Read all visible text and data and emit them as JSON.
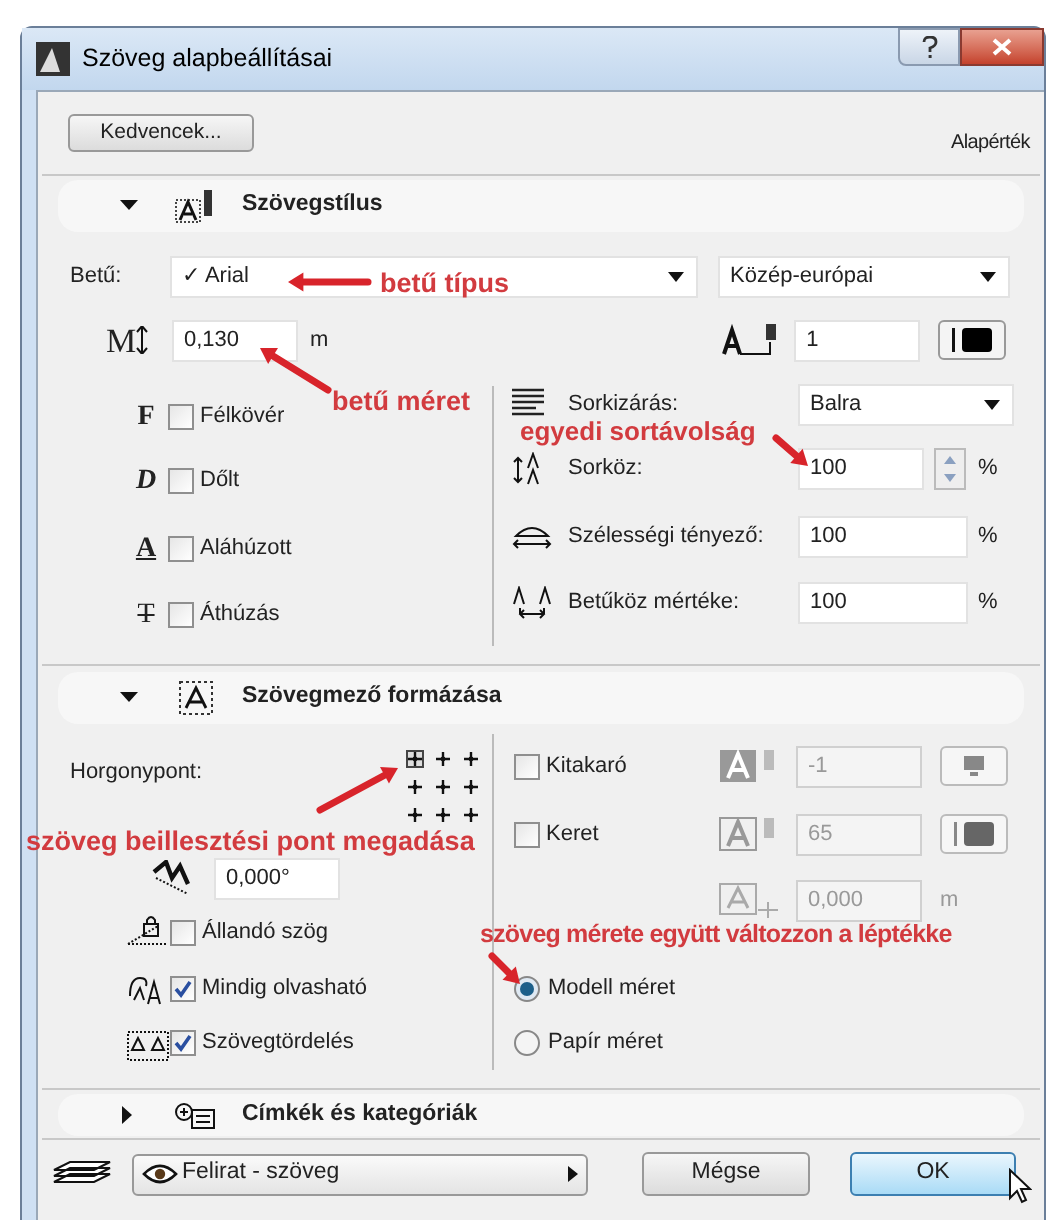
{
  "window": {
    "title": "Szöveg alapbeállításai"
  },
  "toolbar": {
    "favorites_button": "Kedvencek...",
    "default_label": "Alapérték"
  },
  "text_style": {
    "title": "Szövegstílus",
    "expanded": true,
    "font_label": "Betű:",
    "font": "✓ Arial",
    "charset": "Közép-európai",
    "size_icon": "M",
    "size": "0,130",
    "size_unit": "m",
    "pen": "1",
    "styles": [
      {
        "kind": "bold",
        "icon": "F",
        "label": "Félkövér",
        "checked": false
      },
      {
        "kind": "italic",
        "icon": "D",
        "label": "Dőlt",
        "checked": false
      },
      {
        "kind": "underline",
        "icon": "A",
        "label": "Aláhúzott",
        "checked": false
      },
      {
        "kind": "strike",
        "icon": "T",
        "label": "Áthúzás",
        "checked": false
      }
    ],
    "justification": {
      "label": "Sorkizárás:",
      "value": "Balra"
    },
    "line_spacing": {
      "label": "Sorköz:",
      "value": "100",
      "unit": "%"
    },
    "width_factor": {
      "label": "Szélességi tényező:",
      "value": "100",
      "unit": "%"
    },
    "letter_spacing": {
      "label": "Betűköz mértéke:",
      "value": "100",
      "unit": "%"
    }
  },
  "text_block": {
    "title": "Szövegmező formázása",
    "expanded": true,
    "anchor_label": "Horgonypont:",
    "anchor_points": [
      {
        "selected": true
      },
      {
        "selected": false
      },
      {
        "selected": false
      },
      {
        "selected": false
      },
      {
        "selected": false
      },
      {
        "selected": false
      },
      {
        "selected": false
      },
      {
        "selected": false
      },
      {
        "selected": false
      }
    ],
    "angle": "0,000°",
    "options": [
      {
        "label": "Állandó szög",
        "checked": false
      },
      {
        "label": "Mindig olvasható",
        "checked": true
      },
      {
        "label": "Szövegtördelés",
        "checked": true
      }
    ],
    "fill": {
      "label": "Kitakaró",
      "checked": false,
      "pen": "-1"
    },
    "frame": {
      "label": "Keret",
      "checked": false,
      "pen": "65"
    },
    "offset": {
      "value": "0,000",
      "unit": "m",
      "disabled": true
    },
    "scale": [
      {
        "label": "Modell méret",
        "selected": true
      },
      {
        "label": "Papír méret",
        "selected": false
      }
    ]
  },
  "labels_section": {
    "title": "Címkék és kategóriák",
    "expanded": false
  },
  "footer": {
    "layer": "Felirat - szöveg",
    "cancel_button": "Mégse",
    "ok_button": "OK"
  },
  "annotations": [
    {
      "text": "betű típus"
    },
    {
      "text": "betű méret"
    },
    {
      "text": "egyedi sortávolság"
    },
    {
      "text": "szöveg beillesztési pont megadása"
    },
    {
      "text": "szöveg mérete együtt változzon a léptékke"
    }
  ]
}
